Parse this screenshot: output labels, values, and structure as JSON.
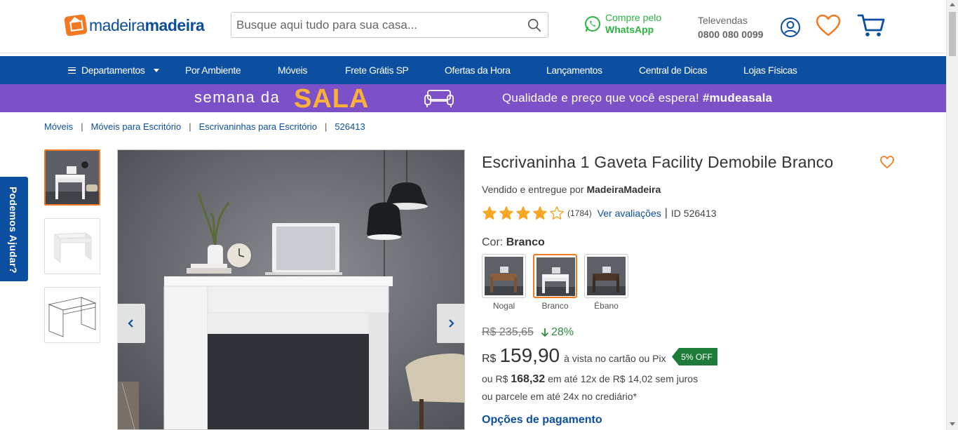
{
  "header": {
    "logo_light": "madeira",
    "logo_bold": "madeira",
    "search_placeholder": "Busque aqui tudo para sua casa...",
    "whatsapp_line1": "Compre pelo",
    "whatsapp_line2": "WhatsApp",
    "televendas_label": "Televendas",
    "televendas_phone": "0800 080 0099",
    "colors": {
      "brand_blue": "#0c4e9f",
      "brand_orange": "#f47920",
      "whatsapp_green": "#2ab540"
    }
  },
  "nav": {
    "items": [
      {
        "label": "Departamentos"
      },
      {
        "label": "Por Ambiente"
      },
      {
        "label": "Móveis"
      },
      {
        "label": "Frete Grátis SP"
      },
      {
        "label": "Ofertas da Hora"
      },
      {
        "label": "Lançamentos"
      },
      {
        "label": "Central de Dicas"
      },
      {
        "label": "Lojas Físicas"
      }
    ]
  },
  "banner": {
    "left_text": "semana da",
    "highlight": "SALA",
    "right_text": "Qualidade e preço que você espera!",
    "hashtag": "#mudeasala",
    "colors": {
      "background": "#7c51c7",
      "highlight": "#fbb03b"
    }
  },
  "breadcrumb": [
    {
      "label": "Móveis"
    },
    {
      "label": "Móveis para Escritório"
    },
    {
      "label": "Escrivaninhas para Escritório"
    },
    {
      "label": "526413"
    }
  ],
  "help_tab": {
    "label": "Podemos Ajudar?"
  },
  "product": {
    "title": "Escrivaninha 1 Gaveta Facility Demobile Branco",
    "sold_by_prefix": "Vendido e entregue por",
    "seller": "MadeiraMadeira",
    "rating": 4,
    "rating_max": 5,
    "review_count": "(1784)",
    "reviews_link": "Ver avaliações",
    "id_label": "ID 526413",
    "color_label": "Cor:",
    "color_value": "Branco",
    "swatches": [
      {
        "name": "Nogal",
        "selected": false
      },
      {
        "name": "Branco",
        "selected": true
      },
      {
        "name": "Ébano",
        "selected": false
      }
    ],
    "old_price": "R$ 235,65",
    "discount": "28%",
    "currency": "R$",
    "price": "159,90",
    "price_desc": "à vista no cartão ou Pix",
    "off_badge": "5% OFF",
    "installment_prefix": "ou R$",
    "installment_total": "168,32",
    "installment_suffix": "em até 12x de R$ 14,02 sem juros",
    "crediario": "ou parcele em até 24x no crediário*",
    "payment_options": "Opções de pagamento"
  }
}
